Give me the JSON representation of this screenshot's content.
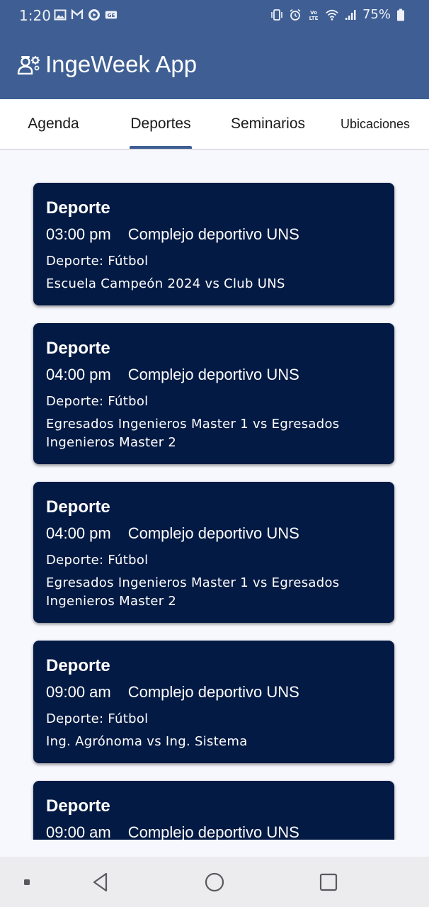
{
  "status_bar": {
    "time": "1:20",
    "battery": "75%",
    "left_icons": [
      "image-icon",
      "gmail-icon",
      "play-icon",
      "ge-icon"
    ],
    "right_icons": [
      "vibrate-icon",
      "alarm-icon",
      "volte-icon",
      "wifi-icon",
      "signal-icon",
      "battery-icon"
    ]
  },
  "app_bar": {
    "title": "IngeWeek App",
    "logo_icon": "engineer-gear-icon"
  },
  "tabs": [
    {
      "label": "Agenda",
      "selected": false
    },
    {
      "label": "Deportes",
      "selected": true
    },
    {
      "label": "Seminarios",
      "selected": false
    },
    {
      "label": "Ubicaciones",
      "selected": false
    }
  ],
  "events": [
    {
      "title": "Deporte",
      "time": "03:00 pm",
      "location": "Complejo deportivo UNS",
      "sport": "Deporte: Fútbol",
      "match": "Escuela Campeón 2024 vs Club UNS"
    },
    {
      "title": "Deporte",
      "time": "04:00 pm",
      "location": "Complejo deportivo UNS",
      "sport": "Deporte: Fútbol",
      "match": "Egresados Ingenieros Master 1 vs Egresados Ingenieros Master 2"
    },
    {
      "title": "Deporte",
      "time": "04:00 pm",
      "location": "Complejo deportivo UNS",
      "sport": "Deporte: Fútbol",
      "match": "Egresados Ingenieros Master 1 vs Egresados Ingenieros Master 2"
    },
    {
      "title": "Deporte",
      "time": "09:00 am",
      "location": "Complejo deportivo UNS",
      "sport": "Deporte: Fútbol",
      "match": "Ing. Agrónoma vs Ing. Sistema"
    },
    {
      "title": "Deporte",
      "time": "09:00 am",
      "location": "Complejo deportivo UNS",
      "sport": "",
      "match": ""
    }
  ],
  "nav_bar": {
    "icons": [
      "recent-dot-icon",
      "back-icon",
      "home-icon",
      "overview-icon"
    ]
  },
  "colors": {
    "app_bar": "#3f5f94",
    "card": "#031a44",
    "background": "#f7f8fe"
  }
}
